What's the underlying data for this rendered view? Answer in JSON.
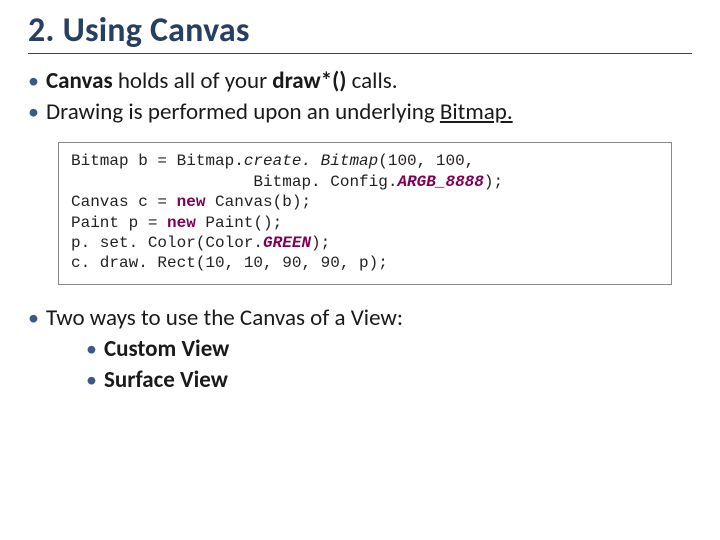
{
  "title": "2. Using Canvas",
  "bullet1": {
    "b1_pre": "Canvas",
    "b1_mid": " holds all of your ",
    "b1_bold": "draw*()",
    "b1_post": " calls."
  },
  "bullet2": {
    "b2_pre": "Drawing is performed upon an underlying ",
    "b2_u": "Bitmap."
  },
  "code": {
    "l1a": "Bitmap b = Bitmap.",
    "l1b": "create. Bitmap",
    "l1c": "(100, 100,",
    "l2a": "                   Bitmap. Config.",
    "l2b": "ARGB_8888",
    "l2c": ");",
    "l3a": "Canvas c = ",
    "l3b": "new",
    "l3c": " Canvas(b);",
    "l4a": "Paint p = ",
    "l4b": "new",
    "l4c": " Paint();",
    "l5a": "p. set. Color(Color.",
    "l5b": "GREEN",
    "l5c": ");",
    "l6": "c. draw. Rect(10, 10, 90, 90, p);"
  },
  "bullet3": "Two ways to use the Canvas of a View:",
  "sub1": "Custom View",
  "sub2": "Surface View"
}
